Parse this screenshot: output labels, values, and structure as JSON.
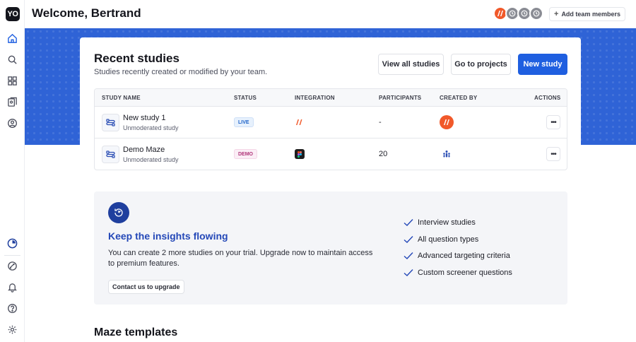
{
  "app": {
    "logo_text": "YO",
    "brand_color": "#f1592a",
    "accent_color": "#1f5fe0"
  },
  "sidebar": {
    "top_items": [
      {
        "name": "home",
        "icon": "home-icon"
      },
      {
        "name": "search",
        "icon": "search-icon"
      },
      {
        "name": "templates",
        "icon": "grid-icon"
      },
      {
        "name": "projects",
        "icon": "folder-icon"
      },
      {
        "name": "panel",
        "icon": "people-icon"
      }
    ],
    "bottom_items": [
      {
        "name": "trial",
        "icon": "clock-pie-icon"
      },
      {
        "name": "integrations",
        "icon": "integrations-icon"
      },
      {
        "name": "notifications",
        "icon": "bell-icon"
      },
      {
        "name": "help",
        "icon": "help-icon"
      },
      {
        "name": "settings",
        "icon": "gear-icon"
      }
    ]
  },
  "header": {
    "welcome": "Welcome, Bertrand",
    "add_team": "Add team members"
  },
  "recent": {
    "title": "Recent studies",
    "subtitle": "Studies recently created or modified by your team.",
    "view_all": "View all studies",
    "go_projects": "Go to projects",
    "new_study": "New study",
    "columns": [
      "STUDY NAME",
      "STATUS",
      "INTEGRATION",
      "PARTICIPANTS",
      "CREATED BY",
      "ACTIONS"
    ],
    "rows": [
      {
        "name": "New study 1",
        "type": "Unmoderated study",
        "status": "LIVE",
        "integration": "maze",
        "participants": "-",
        "creator": "maze"
      },
      {
        "name": "Demo Maze",
        "type": "Unmoderated study",
        "status": "DEMO",
        "integration": "figma",
        "participants": "20",
        "creator": "team"
      }
    ]
  },
  "upsell": {
    "title": "Keep the insights flowing",
    "text": "You can create 2 more studies on your trial. Upgrade now to maintain access to premium features.",
    "button": "Contact us to upgrade",
    "features": [
      "Interview studies",
      "All question types",
      "Advanced targeting criteria",
      "Custom screener questions"
    ]
  },
  "templates": {
    "title": "Maze templates"
  }
}
